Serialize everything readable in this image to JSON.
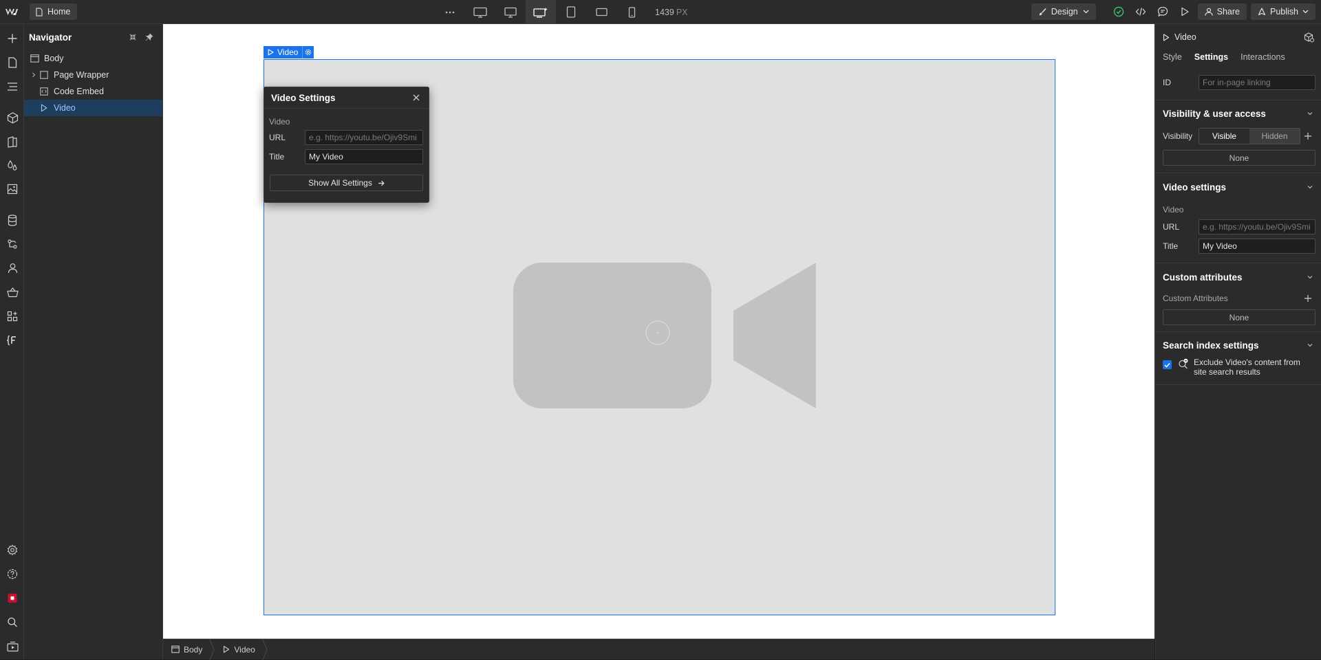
{
  "topbar": {
    "page_name": "Home",
    "width_value": "1439",
    "width_unit": "PX",
    "mode_label": "Design",
    "share_label": "Share",
    "publish_label": "Publish"
  },
  "navigator": {
    "title": "Navigator",
    "items": [
      {
        "label": "Body"
      },
      {
        "label": "Page Wrapper"
      },
      {
        "label": "Code Embed"
      },
      {
        "label": "Video"
      }
    ]
  },
  "canvas": {
    "element_label": "Video"
  },
  "popup": {
    "title": "Video Settings",
    "section": "Video",
    "url_label": "URL",
    "url_placeholder": "e.g. https://youtu.be/Ojiv9Smi",
    "title_label": "Title",
    "title_value": "My Video",
    "show_all_label": "Show All Settings"
  },
  "breadcrumbs": [
    {
      "label": "Body"
    },
    {
      "label": "Video"
    }
  ],
  "right_panel": {
    "element_name": "Video",
    "tabs": [
      {
        "label": "Style"
      },
      {
        "label": "Settings"
      },
      {
        "label": "Interactions"
      }
    ],
    "id_label": "ID",
    "id_placeholder": "For in-page linking",
    "visibility_section": {
      "title": "Visibility & user access",
      "visibility_label": "Visibility",
      "visible_label": "Visible",
      "hidden_label": "Hidden",
      "none_label": "None"
    },
    "video_section": {
      "title": "Video settings",
      "sub_label": "Video",
      "url_label": "URL",
      "url_placeholder": "e.g. https://youtu.be/Ojiv9Smi",
      "title_label": "Title",
      "title_value": "My Video"
    },
    "custom_attr_section": {
      "title": "Custom attributes",
      "sub_label": "Custom Attributes",
      "none_label": "None"
    },
    "search_section": {
      "title": "Search index settings",
      "exclude_label": "Exclude Video's content from site search results",
      "exclude_checked": true
    }
  },
  "colors": {
    "accent": "#1a73e8",
    "panel_bg": "#2b2b2b",
    "canvas_bg": "#ffffff",
    "video_bg": "#e0e0e0"
  }
}
